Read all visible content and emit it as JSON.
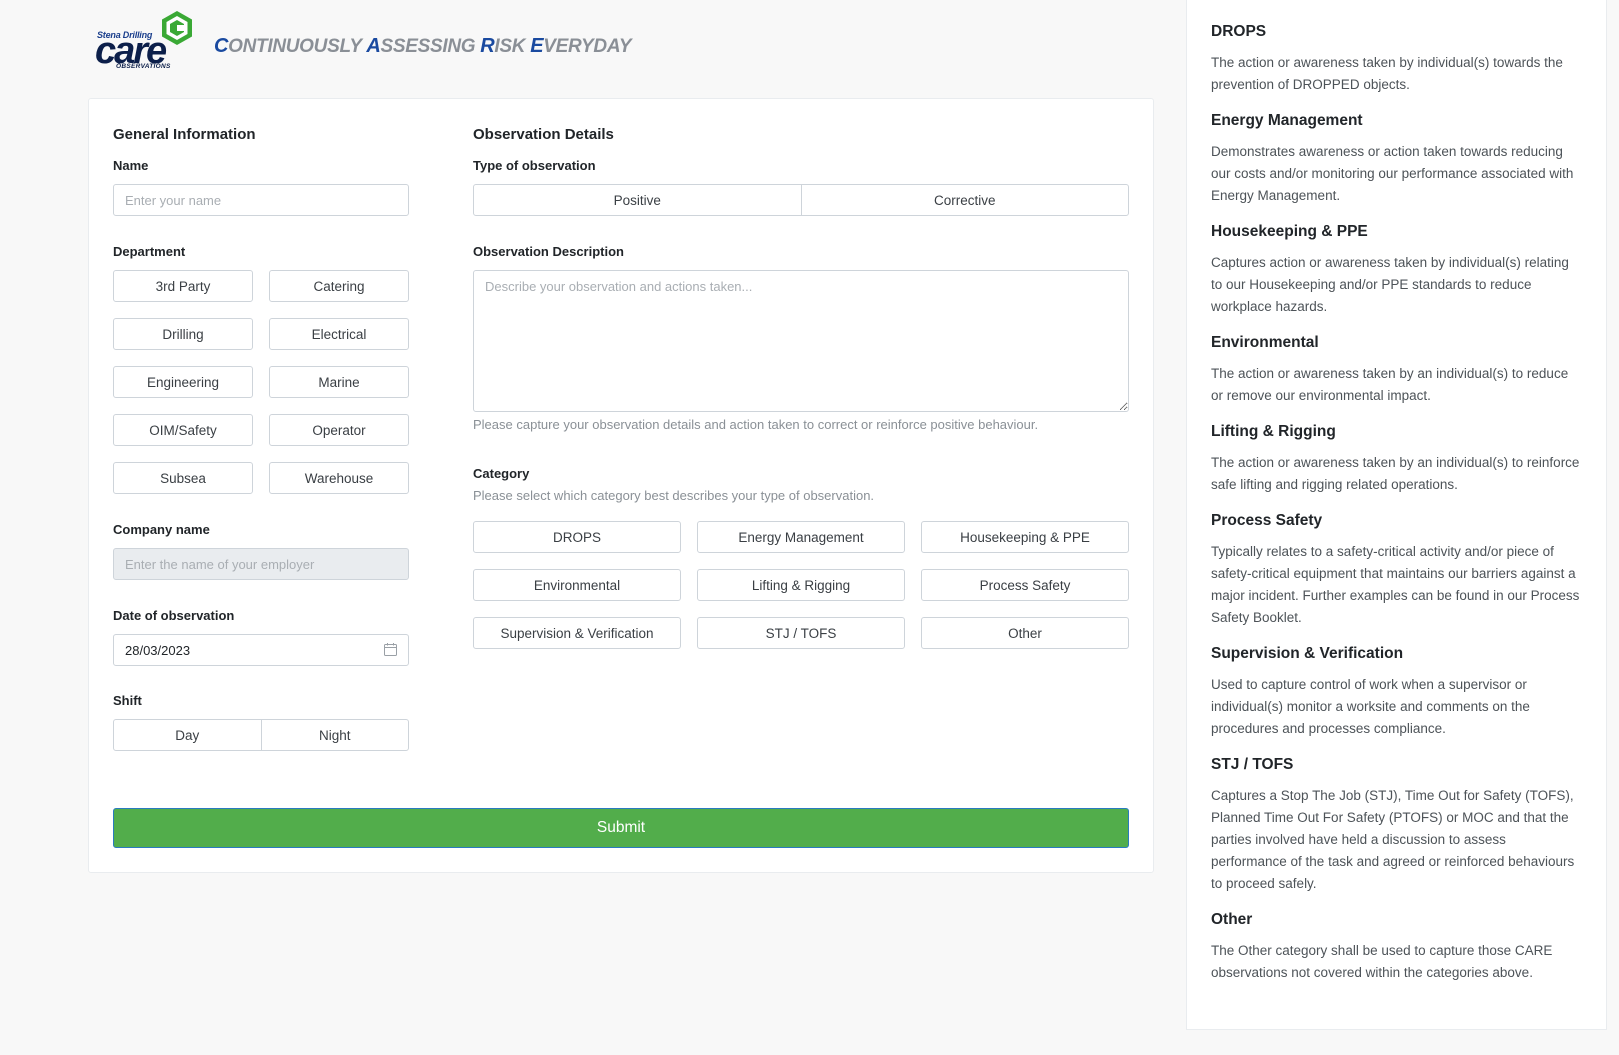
{
  "header": {
    "logo": {
      "brand": "Stena Drilling",
      "word": "care",
      "sub": "OBSERVATIONS"
    },
    "tagline": [
      {
        "hl": "C",
        "rest": "ONTINUOUSLY "
      },
      {
        "hl": "A",
        "rest": "SSESSING "
      },
      {
        "hl": "R",
        "rest": "ISK "
      },
      {
        "hl": "E",
        "rest": "VERYDAY"
      }
    ]
  },
  "general": {
    "title": "General Information",
    "name_label": "Name",
    "name_placeholder": "Enter your name",
    "department_label": "Department",
    "departments": [
      "3rd Party",
      "Catering",
      "Drilling",
      "Electrical",
      "Engineering",
      "Marine",
      "OIM/Safety",
      "Operator",
      "Subsea",
      "Warehouse"
    ],
    "company_label": "Company name",
    "company_placeholder": "Enter the name of your employer",
    "date_label": "Date of observation",
    "date_value": "28/03/2023",
    "shift_label": "Shift",
    "shifts": [
      "Day",
      "Night"
    ]
  },
  "observation": {
    "title": "Observation Details",
    "type_label": "Type of observation",
    "types": [
      "Positive",
      "Corrective"
    ],
    "desc_label": "Observation Description",
    "desc_placeholder": "Describe your observation and actions taken...",
    "desc_help": "Please capture your observation details and action taken to correct or reinforce positive behaviour.",
    "category_label": "Category",
    "category_help": "Please select which category best describes your type of observation.",
    "categories": [
      "DROPS",
      "Energy Management",
      "Housekeeping & PPE",
      "Environmental",
      "Lifting & Rigging",
      "Process Safety",
      "Supervision & Verification",
      "STJ / TOFS",
      "Other"
    ]
  },
  "submit_label": "Submit",
  "colors": {
    "submit_bg": "#52ad4b",
    "tagline_highlight": "#1a4aa0",
    "logo_green": "#3aa935"
  },
  "sidebar": {
    "definitions": [
      {
        "title": "DROPS",
        "text": "The action or awareness taken by individual(s) towards the prevention of DROPPED objects."
      },
      {
        "title": "Energy Management",
        "text": "Demonstrates awareness or action taken towards reducing our costs and/or monitoring our performance associated with Energy Management."
      },
      {
        "title": "Housekeeping & PPE",
        "text": "Captures action or awareness taken by individual(s) relating to our Housekeeping and/or PPE standards to reduce workplace hazards."
      },
      {
        "title": "Environmental",
        "text": "The action or awareness taken by an individual(s) to reduce or remove our environmental impact."
      },
      {
        "title": "Lifting & Rigging",
        "text": "The action or awareness taken by an individual(s) to reinforce safe lifting and rigging related operations."
      },
      {
        "title": "Process Safety",
        "text": "Typically relates to a safety-critical activity and/or piece of safety-critical equipment that maintains our barriers against a major incident. Further examples can be found in our Process Safety Booklet."
      },
      {
        "title": "Supervision & Verification",
        "text": "Used to capture control of work when a supervisor or individual(s) monitor a worksite and comments on the procedures and processes compliance."
      },
      {
        "title": "STJ / TOFS",
        "text": "Captures a Stop The Job (STJ), Time Out for Safety (TOFS), Planned Time Out For Safety (PTOFS) or MOC and that the parties involved have held a discussion to assess performance of the task and agreed or reinforced behaviours to proceed safely."
      },
      {
        "title": "Other",
        "text": "The Other category shall be used to capture those CARE observations not covered within the categories above."
      }
    ]
  }
}
